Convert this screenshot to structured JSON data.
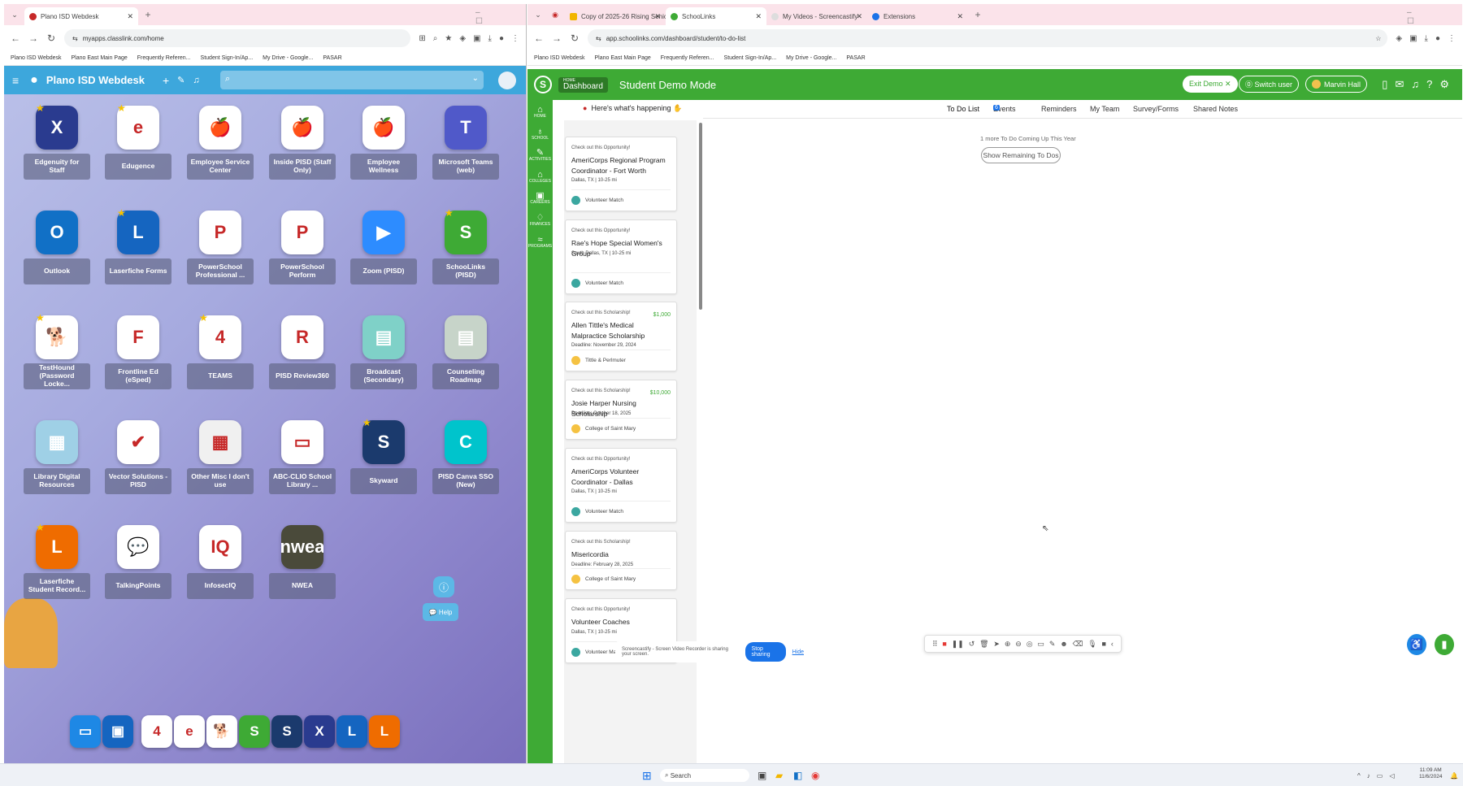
{
  "left_window": {
    "tab_title": "Plano ISD Webdesk",
    "url": "myapps.classlink.com/home",
    "bookmarks": [
      "Plano ISD Webdesk",
      "Plano East Main Page",
      "Frequently Referen...",
      "Student Sign-In/Ap...",
      "My Drive - Google...",
      "PASAR"
    ],
    "header_title": "Plano ISD Webdesk",
    "apps": [
      {
        "label": "Edgenuity for Staff",
        "icon": "edgenuity-icon",
        "color": "#2a3b8f",
        "glyph": "X",
        "star": true
      },
      {
        "label": "Edugence",
        "icon": "edugence-icon",
        "color": "#ffffff",
        "glyph": "e",
        "star": true
      },
      {
        "label": "Employee Service Center",
        "icon": "apple-logo-icon",
        "color": "#ffffff",
        "glyph": "🍎",
        "star": false
      },
      {
        "label": "Inside PISD (Staff Only)",
        "icon": "apple-logo-icon",
        "color": "#ffffff",
        "glyph": "🍎",
        "star": false
      },
      {
        "label": "Employee Wellness",
        "icon": "apple-logo-icon",
        "color": "#ffffff",
        "glyph": "🍎",
        "star": false
      },
      {
        "label": "Microsoft Teams (web)",
        "icon": "teams-icon",
        "color": "#5059c9",
        "glyph": "T",
        "star": false
      },
      {
        "label": "Outlook",
        "icon": "outlook-icon",
        "color": "#1170c6",
        "glyph": "O",
        "star": false
      },
      {
        "label": "Laserfiche Forms",
        "icon": "laserfiche-icon",
        "color": "#1565c0",
        "glyph": "L",
        "star": true
      },
      {
        "label": "PowerSchool Professional ...",
        "icon": "powerschool-icon",
        "color": "#ffffff",
        "glyph": "P",
        "star": false
      },
      {
        "label": "PowerSchool Perform",
        "icon": "powerschool-icon",
        "color": "#ffffff",
        "glyph": "P",
        "star": false
      },
      {
        "label": "Zoom (PISD)",
        "icon": "zoom-icon",
        "color": "#2d8cff",
        "glyph": "▶",
        "star": false
      },
      {
        "label": "SchooLinks (PISD)",
        "icon": "schoolinks-icon",
        "color": "#3eaa35",
        "glyph": "S",
        "star": true
      },
      {
        "label": "TestHound (Password Locke...",
        "icon": "testhound-icon",
        "color": "#ffffff",
        "glyph": "🐕",
        "star": true
      },
      {
        "label": "Frontline Ed (eSped)",
        "icon": "frontline-icon",
        "color": "#ffffff",
        "glyph": "F",
        "star": false
      },
      {
        "label": "TEAMS",
        "icon": "teams-tx-icon",
        "color": "#ffffff",
        "glyph": "4",
        "star": true
      },
      {
        "label": "PISD Review360",
        "icon": "review360-icon",
        "color": "#ffffff",
        "glyph": "R",
        "star": false
      },
      {
        "label": "Broadcast (Secondary)",
        "icon": "folder-icon",
        "color": "#7fd1c8",
        "glyph": "▤",
        "star": false
      },
      {
        "label": "Counseling Roadmap",
        "icon": "folder-icon",
        "color": "#c7d4c9",
        "glyph": "▤",
        "star": false
      },
      {
        "label": "Library Digital Resources",
        "icon": "folder-icon",
        "color": "#9fd0e6",
        "glyph": "▦",
        "star": false
      },
      {
        "label": "Vector Solutions - PISD",
        "icon": "vector-icon",
        "color": "#ffffff",
        "glyph": "✔",
        "star": false
      },
      {
        "label": "Other Misc I don't use",
        "icon": "folder-icon",
        "color": "#f0f0f0",
        "glyph": "▦",
        "star": false
      },
      {
        "label": "ABC-CLIO School Library ...",
        "icon": "abcclio-icon",
        "color": "#ffffff",
        "glyph": "▭",
        "star": false
      },
      {
        "label": "Skyward",
        "icon": "skyward-icon",
        "color": "#1b3a6d",
        "glyph": "S",
        "star": true
      },
      {
        "label": "PISD Canva SSO (New)",
        "icon": "canva-icon",
        "color": "#00c4cc",
        "glyph": "C",
        "star": false
      },
      {
        "label": "Laserfiche Student Record...",
        "icon": "laserfiche-icon",
        "color": "#ef6c00",
        "glyph": "L",
        "star": true
      },
      {
        "label": "TalkingPoints",
        "icon": "talkingpoints-icon",
        "color": "#ffffff",
        "glyph": "💬",
        "star": false
      },
      {
        "label": "InfosecIQ",
        "icon": "infosec-icon",
        "color": "#ffffff",
        "glyph": "IQ",
        "star": false
      },
      {
        "label": "NWEA",
        "icon": "nwea-icon",
        "color": "#4a4a3a",
        "glyph": "nwea",
        "star": false
      }
    ],
    "help_label": "Help",
    "dock": [
      {
        "name": "files-dock-icon",
        "color": "#1e88e5",
        "glyph": "▭"
      },
      {
        "name": "screen-dock-icon",
        "color": "#1565c0",
        "glyph": "▣"
      },
      {
        "name": "teams-tx-dock-icon",
        "color": "#ffffff",
        "glyph": "4"
      },
      {
        "name": "edugence-dock-icon",
        "color": "#ffffff",
        "glyph": "e"
      },
      {
        "name": "testhound-dock-icon",
        "color": "#ffffff",
        "glyph": "🐕"
      },
      {
        "name": "schoolinks-dock-icon",
        "color": "#3eaa35",
        "glyph": "S"
      },
      {
        "name": "skyward-dock-icon",
        "color": "#1b3a6d",
        "glyph": "S"
      },
      {
        "name": "edgenuity-dock-icon",
        "color": "#2a3b8f",
        "glyph": "X"
      },
      {
        "name": "laserfiche-dock-icon",
        "color": "#1565c0",
        "glyph": "L"
      },
      {
        "name": "laserfiche-student-dock-icon",
        "color": "#ef6c00",
        "glyph": "L"
      }
    ]
  },
  "right_window": {
    "tabs": [
      "Copy of 2025-26 Rising Senio",
      "SchooLinks",
      "My Videos - Screencastify",
      "Extensions"
    ],
    "url": "app.schoolinks.com/dashboard/student/to-do-list",
    "bookmarks": [
      "Plano ISD Webdesk",
      "Plano East Main Page",
      "Frequently Referen...",
      "Student Sign-In/Ap...",
      "My Drive - Google...",
      "PASAR"
    ],
    "dashboard_small": "HOME",
    "dashboard_label": "Dashboard",
    "demo_title": "Student Demo Mode",
    "exit_demo": "Exit Demo ✕",
    "switch_user": "Switch user",
    "user_name": "Marvin Hall",
    "sidebar": [
      "HOME",
      "SCHOOL",
      "ACTIVITIES",
      "COLLEGES",
      "CAREERS",
      "FINANCES",
      "PROGRAMS"
    ],
    "feed_heading": "Here's what's happening",
    "cards": [
      {
        "kicker": "Check out this Opportunity!",
        "amount": "",
        "title": "AmeriCorps Regional Program Coordinator - Fort Worth",
        "meta": "Dallas, TX | 10-25 mi",
        "source": "Volunteer Match",
        "src_color": "#3ba7a0"
      },
      {
        "kicker": "Check out this Opportunity!",
        "amount": "",
        "title": "Rae's Hope Special Women's Group",
        "meta": "South Dallas, TX | 10-25 mi",
        "source": "Volunteer Match",
        "src_color": "#3ba7a0"
      },
      {
        "kicker": "Check out this Scholarship!",
        "amount": "$1,000",
        "title": "Allen Tittle's Medical Malpractice Scholarship",
        "meta": "Deadline: November 29, 2024",
        "source": "Tittle & Perlmuter",
        "src_color": "#f5c242"
      },
      {
        "kicker": "Check out this Scholarship!",
        "amount": "$10,000",
        "title": "Josie Harper Nursing Scholarship",
        "meta": "Deadline: October 18, 2025",
        "source": "College of Saint Mary",
        "src_color": "#f5c242"
      },
      {
        "kicker": "Check out this Opportunity!",
        "amount": "",
        "title": "AmeriCorps Volunteer Coordinator - Dallas",
        "meta": "Dallas, TX | 10-25 mi",
        "source": "Volunteer Match",
        "src_color": "#3ba7a0"
      },
      {
        "kicker": "Check out this Scholarship!",
        "amount": "",
        "title": "Misericordia",
        "meta": "Deadline: February 28, 2025",
        "source": "College of Saint Mary",
        "src_color": "#f5c242"
      },
      {
        "kicker": "Check out this Opportunity!",
        "amount": "",
        "title": "Volunteer Coaches",
        "meta": "Dallas, TX | 10-25 mi",
        "source": "Volunteer Match",
        "src_color": "#3ba7a0"
      }
    ],
    "main_tabs": [
      "To Do List",
      "Events",
      "Reminders",
      "My Team",
      "Survey/Forms",
      "Shared Notes"
    ],
    "events_badge": "6",
    "todo_note": "1 more To Do Coming Up This Year",
    "show_remaining": "Show Remaining To Dos",
    "share_text": "Screencastify - Screen Video Recorder is sharing your screen.",
    "stop_sharing": "Stop sharing",
    "hide": "Hide"
  },
  "taskbar": {
    "search": "Search",
    "time": "11:09 AM",
    "date": "11/6/2024"
  },
  "colors": {
    "classlink_blue": "#3da7dc",
    "schoolinks_green": "#3eaa35",
    "chrome_tab_pink": "#fbe3ea"
  }
}
